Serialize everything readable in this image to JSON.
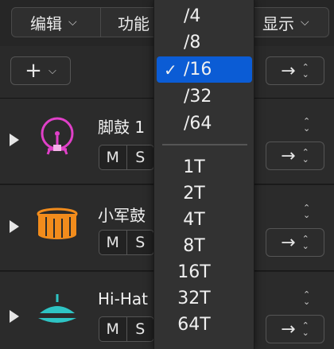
{
  "menubar": {
    "edit_label": "编辑",
    "functions_label": "功能",
    "view_label": "显示"
  },
  "header": {
    "add_label": "+",
    "arrow_label": "→"
  },
  "tracks": [
    {
      "name": "脚鼓 1",
      "mute": "M",
      "solo": "S",
      "icon": "kick-drum-icon",
      "icon_color": "#e040c8"
    },
    {
      "name": "小军鼓",
      "mute": "M",
      "solo": "S",
      "icon": "snare-drum-icon",
      "icon_color": "#f28c1c"
    },
    {
      "name": "Hi-Hat",
      "mute": "M",
      "solo": "S",
      "icon": "hi-hat-icon",
      "icon_color": "#2ec4c4"
    }
  ],
  "dropdown": {
    "items": [
      "/4",
      "/8",
      "/16",
      "/32",
      "/64"
    ],
    "selected": "/16",
    "check_mark": "✓",
    "triplet_items": [
      "1T",
      "2T",
      "4T",
      "8T",
      "16T",
      "32T",
      "64T"
    ]
  },
  "colors": {
    "selection": "#0b5cd5",
    "kick": "#e040c8",
    "snare": "#f28c1c",
    "hihat": "#2ec4c4"
  }
}
